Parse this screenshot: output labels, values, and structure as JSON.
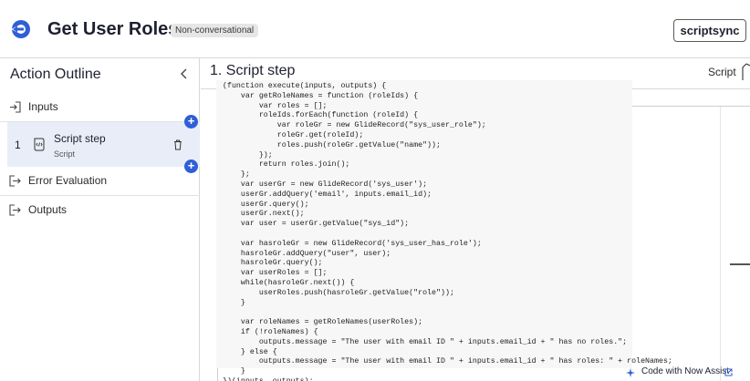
{
  "header": {
    "title": "Get User Roles",
    "badge": "Non-conversational",
    "scriptsync_label": "scriptsync"
  },
  "sidebar": {
    "title": "Action Outline",
    "inputs_label": "Inputs",
    "step": {
      "number": "1",
      "title": "Script step",
      "subtitle": "Script"
    },
    "error_label": "Error Evaluation",
    "outputs_label": "Outputs"
  },
  "main": {
    "title": "1.  Script step",
    "type_label": "Script"
  },
  "code_lines": [
    "(function execute(inputs, outputs) {",
    "    var getRoleNames = function (roleIds) {",
    "        var roles = [];",
    "        roleIds.forEach(function (roleId) {",
    "            var roleGr = new GlideRecord(\"sys_user_role\");",
    "            roleGr.get(roleId);",
    "            roles.push(roleGr.getValue(\"name\"));",
    "        });",
    "        return roles.join();",
    "    };",
    "    var userGr = new GlideRecord('sys_user');",
    "    userGr.addQuery('email', inputs.email_id);",
    "    userGr.query();",
    "    userGr.next();",
    "    var user = userGr.getValue(\"sys_id\");",
    "",
    "    var hasroleGr = new GlideRecord('sys_user_has_role');",
    "    hasroleGr.addQuery(\"user\", user);",
    "    hasroleGr.query();",
    "    var userRoles = [];",
    "    while(hasroleGr.next()) {",
    "        userRoles.push(hasroleGr.getValue(\"role\"));",
    "    }",
    "",
    "    var roleNames = getRoleNames(userRoles);",
    "    if (!roleNames) {",
    "        outputs.message = \"The user with email ID \" + inputs.email_id + \" has no roles.\";",
    "    } else {",
    "        outputs.message = \"The user with email ID \" + inputs.email_id + \" has roles: \" + roleNames;",
    "    }",
    "})(inputs, outputs);"
  ],
  "footer": {
    "now_assist_label": "Code with Now Assist"
  },
  "colors": {
    "accent": "#2f5fd7",
    "selected_bg": "#e8edf7",
    "code_bg": "#f7f7f7"
  },
  "icons": {
    "back": "back-arrow-circle-icon",
    "collapse": "chevron-left-icon",
    "inputs": "sign-in-icon",
    "step": "script-scroll-icon",
    "trash": "trash-icon",
    "error": "sign-out-icon",
    "outputs": "sign-out-icon",
    "add": "plus-icon",
    "now_assist": "sparkle-icon",
    "external": "external-link-icon"
  }
}
